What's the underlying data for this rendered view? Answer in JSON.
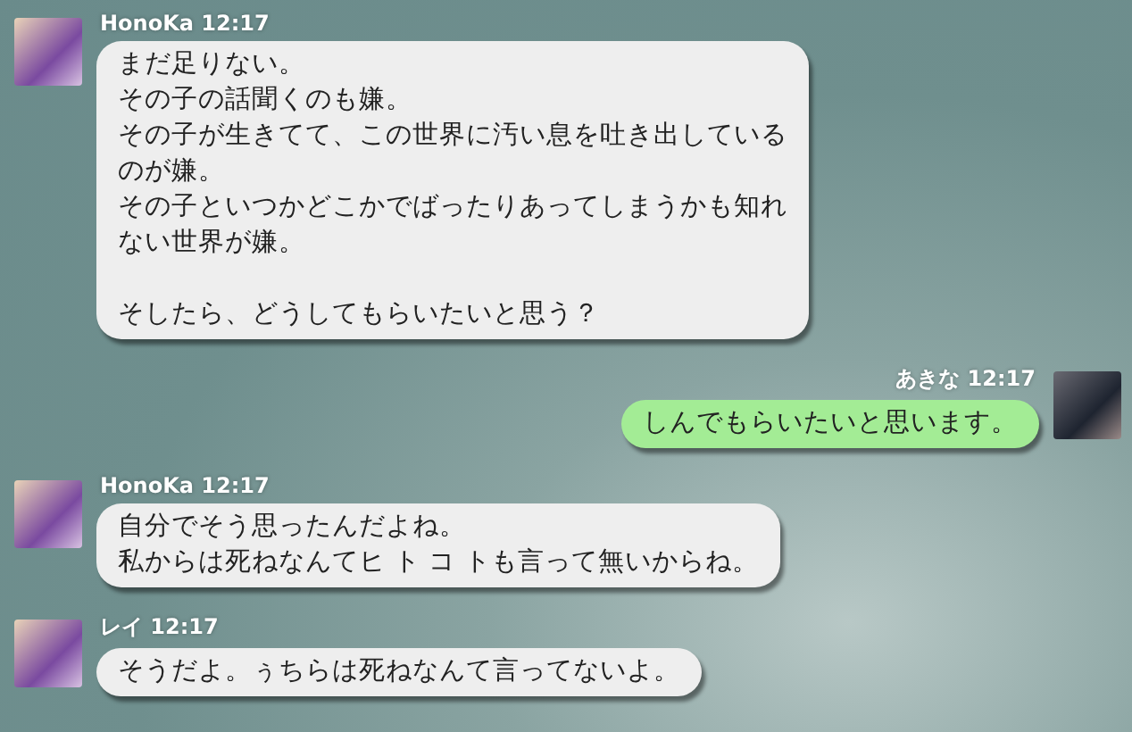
{
  "messages": [
    {
      "kind": "received",
      "sender": "HonoKa",
      "time": "12:17",
      "paragraphs": [
        [
          "まだ足りない。",
          "その子の話聞くのも嫌。",
          "その子が生きてて、この世界に汚い息を吐き出している",
          "のが嫌。",
          "その子といつかどこかでばったりあってしまうかも知れ",
          "ない世界が嫌。"
        ],
        [
          "そしたら、どうしてもらいたいと思う？"
        ]
      ]
    },
    {
      "kind": "sent",
      "sender": "あきな",
      "time": "12:17",
      "paragraphs": [
        [
          "しんでもらいたいと思います。"
        ]
      ]
    },
    {
      "kind": "received",
      "sender": "HonoKa",
      "time": "12:17",
      "paragraphs": [
        [
          "自分でそう思ったんだよね。",
          "私からは死ねなんてヒ ト コ トも言って無いからね。"
        ]
      ]
    },
    {
      "kind": "received",
      "sender": "レイ",
      "time": "12:17",
      "paragraphs": [
        [
          "そうだよ。ぅちらは死ねなんて言ってないよ。"
        ]
      ]
    }
  ]
}
